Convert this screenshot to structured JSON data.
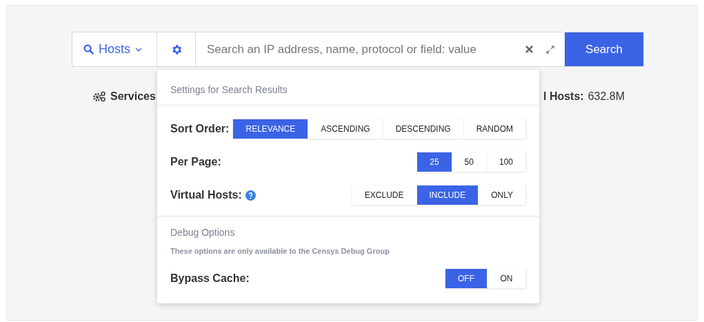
{
  "search_bar": {
    "scope": "Hosts",
    "placeholder": "Search an IP address, name, protocol or field: value",
    "button": "Search"
  },
  "stats": [
    {
      "label": "Services"
    },
    {
      "label": "l Hosts:",
      "value": "632.8M"
    }
  ],
  "settings": {
    "title": "Settings for Search Results",
    "groups": [
      {
        "label": "Sort Order:",
        "help": false,
        "options": [
          {
            "label": "RELEVANCE",
            "selected": true
          },
          {
            "label": "ASCENDING",
            "selected": false
          },
          {
            "label": "DESCENDING",
            "selected": false
          },
          {
            "label": "RANDOM",
            "selected": false
          }
        ]
      },
      {
        "label": "Per Page:",
        "help": false,
        "options": [
          {
            "label": "25",
            "selected": true
          },
          {
            "label": "50",
            "selected": false
          },
          {
            "label": "100",
            "selected": false
          }
        ]
      },
      {
        "label": "Virtual Hosts:",
        "help": true,
        "options": [
          {
            "label": "EXCLUDE",
            "selected": false
          },
          {
            "label": "INCLUDE",
            "selected": true
          },
          {
            "label": "ONLY",
            "selected": false
          }
        ]
      }
    ],
    "debug_title": "Debug Options",
    "debug_note": "These options are only available to the Censys Debug Group",
    "debug_groups": [
      {
        "label": "Bypass Cache:",
        "options": [
          {
            "label": "OFF",
            "selected": true
          },
          {
            "label": "ON",
            "selected": false
          }
        ]
      }
    ]
  }
}
